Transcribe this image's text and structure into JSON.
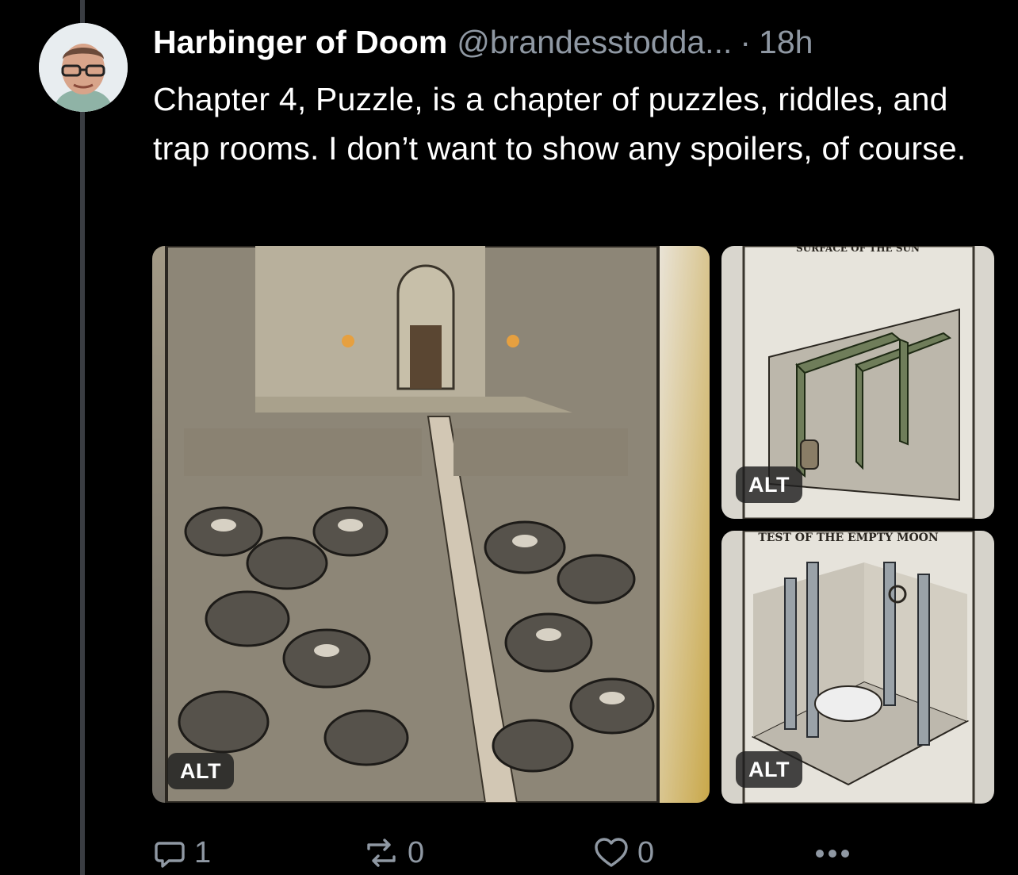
{
  "post": {
    "author_name": "Harbinger of Doom",
    "author_handle": "@brandesstodda...",
    "separator": "·",
    "time": "18h",
    "text": "Chapter 4, Puzzle, is a chapter of puzzles, riddles, and trap rooms. I don’t want to show any spoilers, of course."
  },
  "media": [
    {
      "alt_label": "ALT",
      "caption": ""
    },
    {
      "alt_label": "ALT",
      "caption": "SURFACE OF THE SUN"
    },
    {
      "alt_label": "ALT",
      "caption": "TEST OF THE EMPTY MOON"
    }
  ],
  "actions": {
    "replies": "1",
    "reposts": "0",
    "likes": "0",
    "more_icon": "ellipsis-icon"
  },
  "colors": {
    "background": "#000000",
    "text": "#ffffff",
    "muted": "#8f98a3",
    "thread_line": "#3a3d42"
  }
}
